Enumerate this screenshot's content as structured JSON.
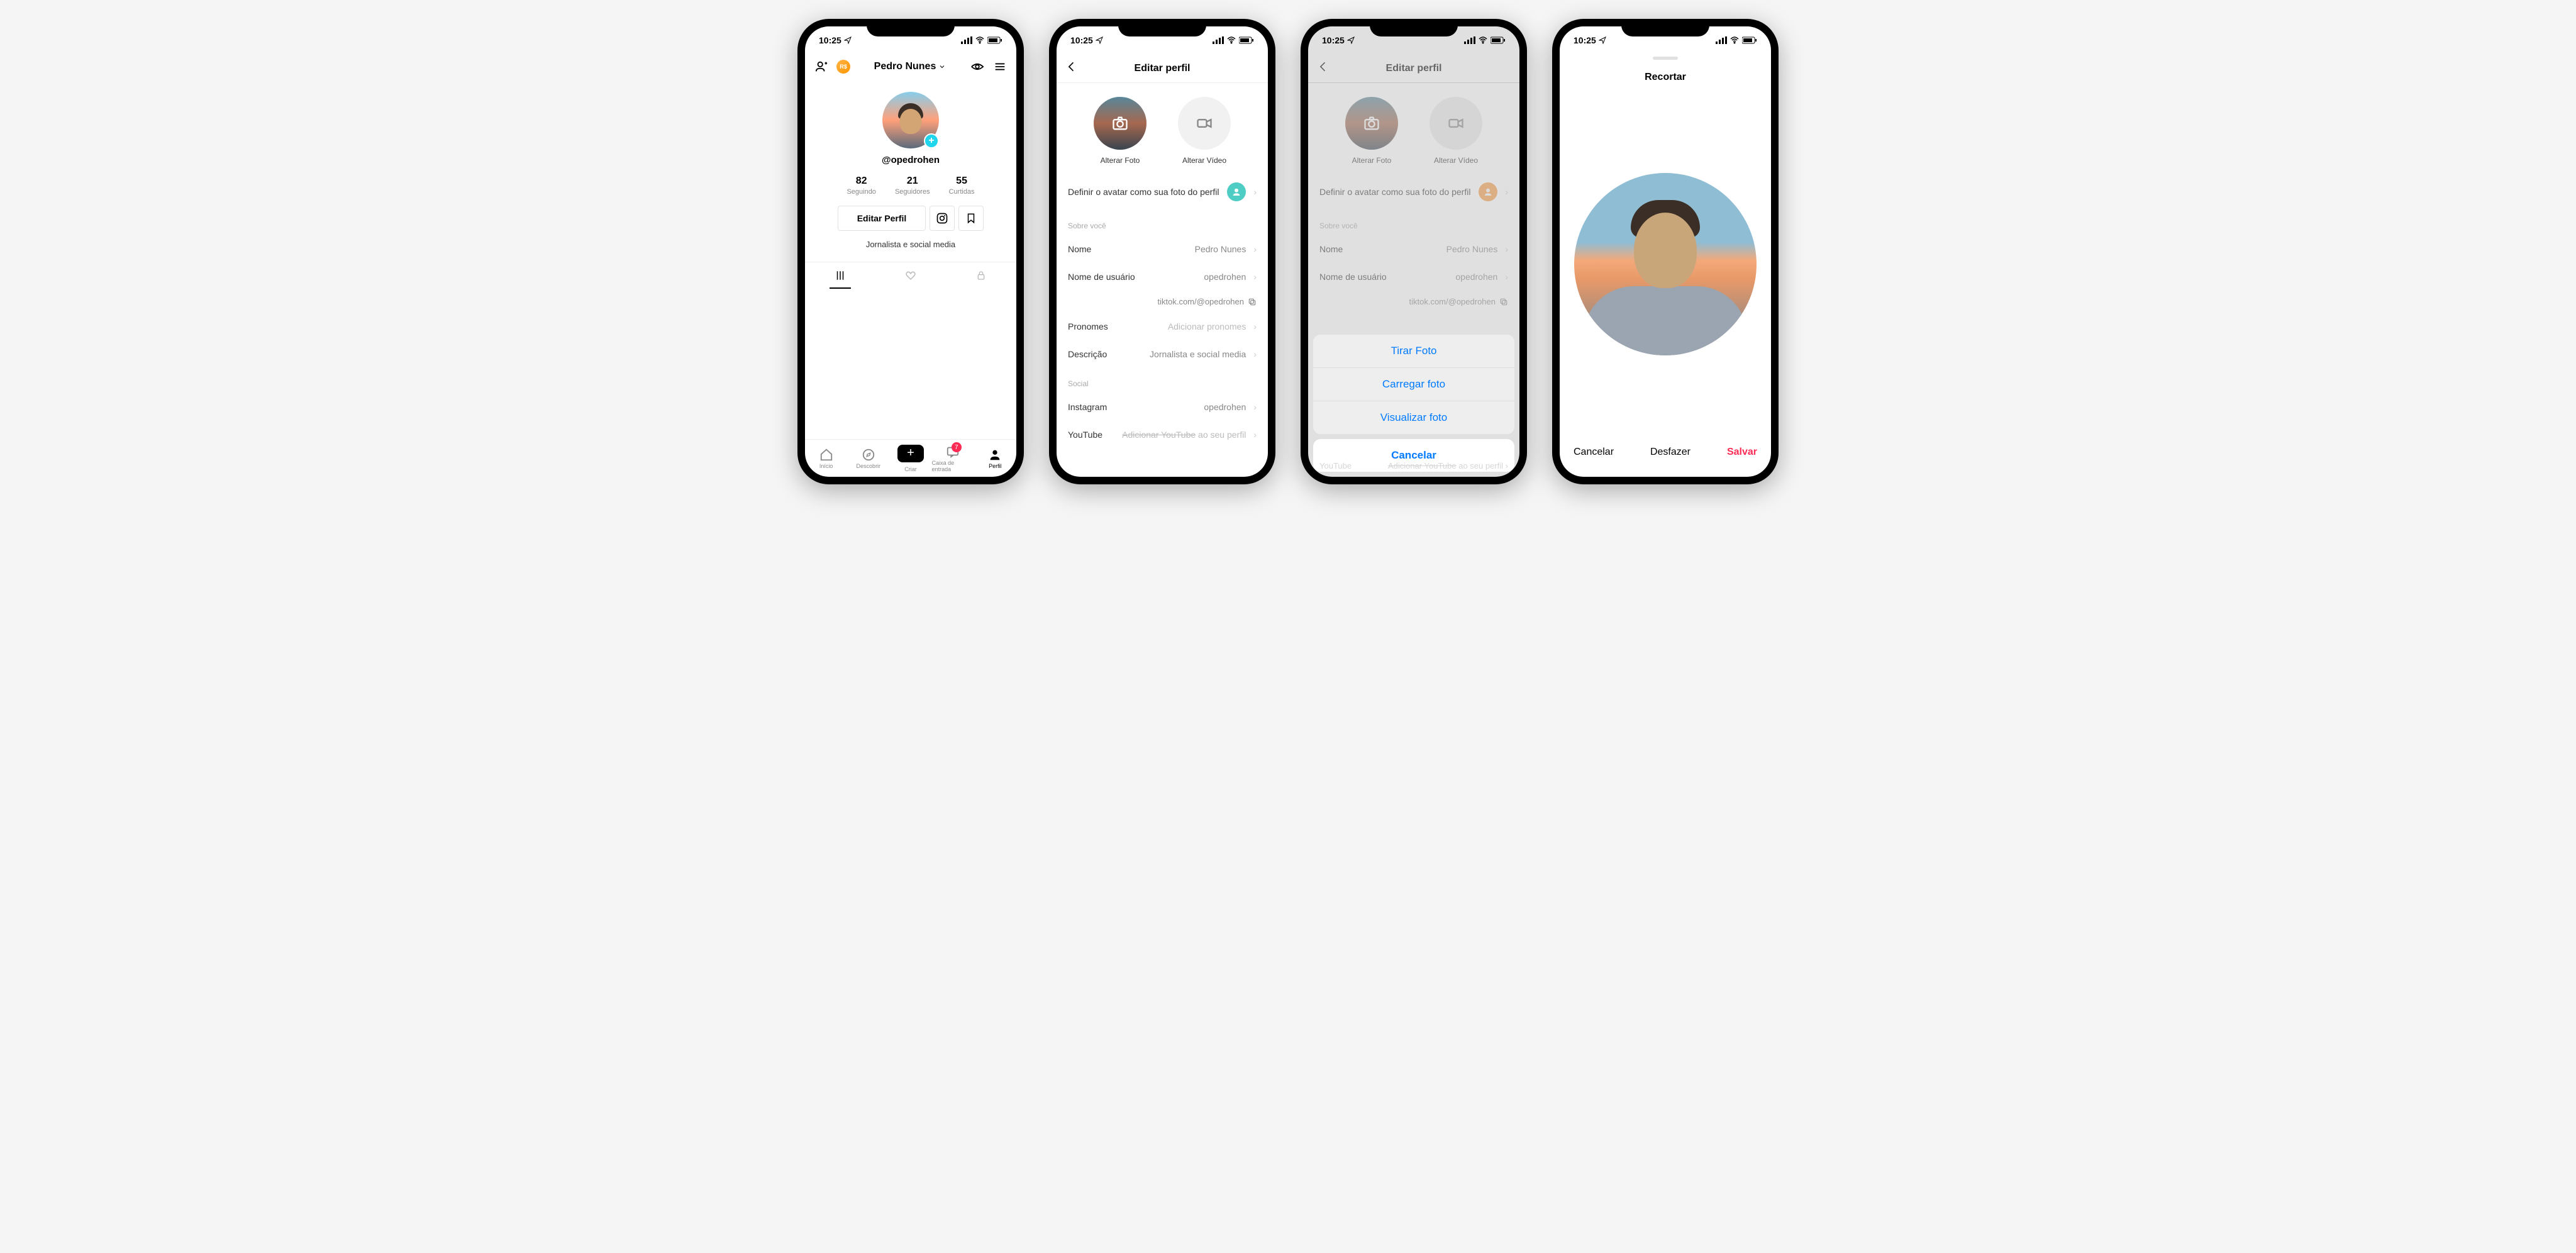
{
  "status": {
    "time": "10:25"
  },
  "screen1": {
    "title": "Pedro Nunes",
    "username": "@opedrohen",
    "stats": {
      "following_num": "82",
      "following_label": "Seguindo",
      "followers_num": "21",
      "followers_label": "Seguidores",
      "likes_num": "55",
      "likes_label": "Curtidas"
    },
    "edit_label": "Editar Perfil",
    "bio": "Jornalista e social media",
    "nav": {
      "home": "Início",
      "discover": "Descobrir",
      "create": "Criar",
      "inbox": "Caixa de entrada",
      "inbox_badge": "7",
      "profile": "Perfil"
    }
  },
  "screen2": {
    "title": "Editar perfil",
    "change_photo": "Alterar Foto",
    "change_video": "Alterar Vídeo",
    "avatar_row": "Definir o avatar como sua foto do perfil",
    "section_about": "Sobre você",
    "name_label": "Nome",
    "name_value": "Pedro Nunes",
    "username_label": "Nome de usuário",
    "username_value": "opedrohen",
    "profile_url": "tiktok.com/@opedrohen",
    "pronouns_label": "Pronomes",
    "pronouns_value": "Adicionar pronomes",
    "desc_label": "Descrição",
    "desc_value": "Jornalista e social media",
    "section_social": "Social",
    "instagram_label": "Instagram",
    "instagram_value": "opedrohen",
    "youtube_label": "YouTube",
    "youtube_value_strike": "Adicionar YouTube",
    "youtube_value_rest": " ao seu perfil"
  },
  "screen3": {
    "sheet": {
      "take": "Tirar Foto",
      "load": "Carregar foto",
      "view": "Visualizar foto",
      "cancel": "Cancelar"
    }
  },
  "screen4": {
    "title": "Recortar",
    "cancel": "Cancelar",
    "undo": "Desfazer",
    "save": "Salvar"
  }
}
